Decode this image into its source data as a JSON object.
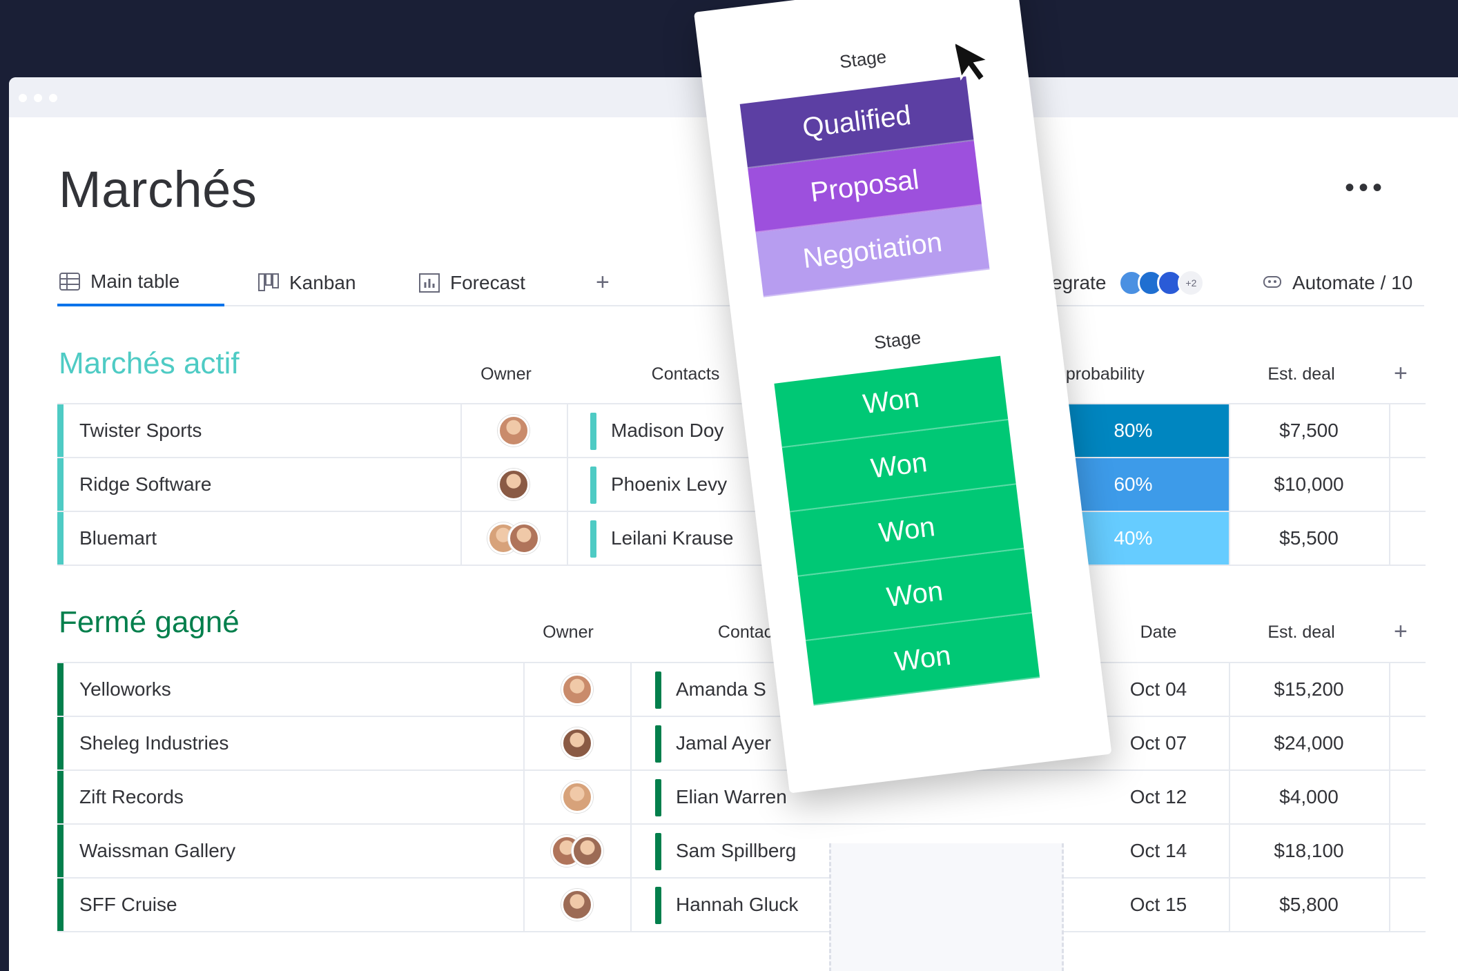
{
  "board": {
    "title": "Marchés",
    "more_label": "•••"
  },
  "tabs": [
    {
      "label": "Main table",
      "icon": "table-icon"
    },
    {
      "label": "Kanban",
      "icon": "kanban-icon"
    },
    {
      "label": "Forecast",
      "icon": "chart-icon"
    }
  ],
  "tab_add": "+",
  "integrate": {
    "label": "egrate",
    "more": "+2"
  },
  "automate": {
    "label": "Automate / 10"
  },
  "groups": {
    "active": {
      "title": "Marchés actif",
      "color": "#4ecbc4",
      "columns": {
        "owner": "Owner",
        "contacts": "Contacts",
        "prob": "Close probability",
        "deal": "Est. deal",
        "add": "+"
      },
      "rows": [
        {
          "name": "Twister Sports",
          "contact": "Madison Doy",
          "prob": "80%",
          "prob_color": "#0086c0",
          "deal": "$7,500"
        },
        {
          "name": "Ridge Software",
          "contact": "Phoenix Levy",
          "prob": "60%",
          "prob_color": "#3d9be9",
          "deal": "$10,000"
        },
        {
          "name": "Bluemart",
          "contact": "Leilani Krause",
          "prob": "40%",
          "prob_color": "#66ccff",
          "deal": "$5,500"
        }
      ]
    },
    "won": {
      "title": "Fermé gagné",
      "color": "#037f4c",
      "columns": {
        "owner": "Owner",
        "contacts": "Contact",
        "date": "Date",
        "deal": "Est. deal",
        "add": "+"
      },
      "rows": [
        {
          "name": "Yelloworks",
          "contact": "Amanda S",
          "date": "Oct 04",
          "deal": "$15,200"
        },
        {
          "name": "Sheleg Industries",
          "contact": "Jamal Ayer",
          "date": "Oct 07",
          "deal": "$24,000"
        },
        {
          "name": "Zift Records",
          "contact": "Elian Warren",
          "date": "Oct 12",
          "deal": "$4,000"
        },
        {
          "name": "Waissman Gallery",
          "contact": "Sam Spillberg",
          "date": "Oct 14",
          "deal": "$18,100"
        },
        {
          "name": "SFF Cruise",
          "contact": "Hannah Gluck",
          "date": "Oct 15",
          "deal": "$5,800"
        }
      ]
    }
  },
  "stage_popup": {
    "label_top": "Stage",
    "label_bottom": "Stage",
    "options": [
      {
        "label": "Qualified",
        "color": "#5c3fa3"
      },
      {
        "label": "Proposal",
        "color": "#9d50dd"
      },
      {
        "label": "Negotiation",
        "color": "#b79df0"
      }
    ],
    "won": [
      "Won",
      "Won",
      "Won",
      "Won",
      "Won"
    ],
    "won_color": "#00c875"
  }
}
